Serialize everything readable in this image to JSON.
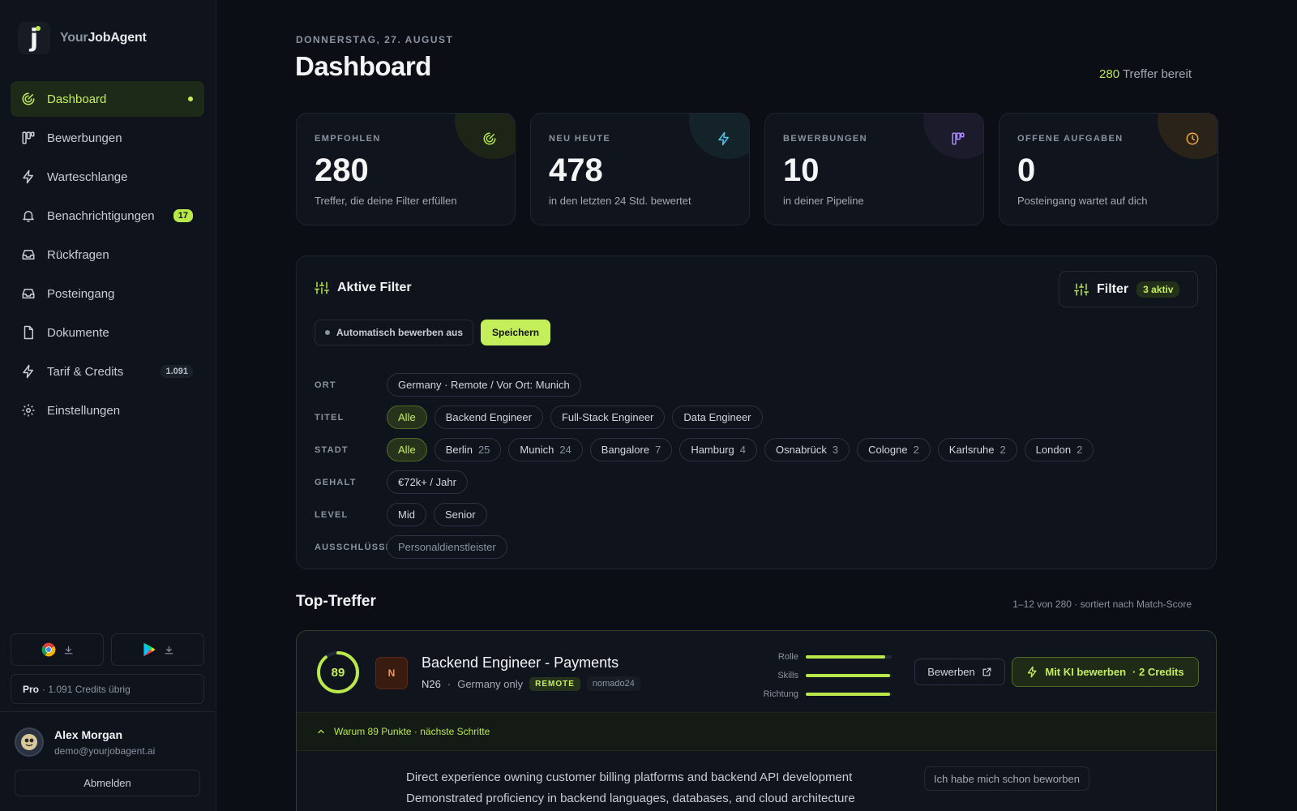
{
  "app": {
    "brand_dim": "Your",
    "brand_bold": "JobAgent"
  },
  "sidebar": {
    "items": [
      {
        "label": "Dashboard"
      },
      {
        "label": "Bewerbungen"
      },
      {
        "label": "Warteschlange"
      },
      {
        "label": "Benachrichtigungen",
        "badge": "17"
      },
      {
        "label": "Rückfragen"
      },
      {
        "label": "Posteingang"
      },
      {
        "label": "Dokumente"
      },
      {
        "label": "Tarif & Credits",
        "badge": "1.091"
      },
      {
        "label": "Einstellungen"
      }
    ],
    "plan_name": "Pro",
    "plan_text": "· 1.091 Credits übrig",
    "user_name": "Alex Morgan",
    "user_email": "demo@yourjobagent.ai",
    "logout_label": "Abmelden"
  },
  "header": {
    "date": "DONNERSTAG, 27. AUGUST",
    "title": "Dashboard",
    "ready_count": "280",
    "ready_text": "Treffer bereit"
  },
  "stats": [
    {
      "label": "EMPFOHLEN",
      "value": "280",
      "desc": "Treffer, die deine Filter erfüllen"
    },
    {
      "label": "NEU HEUTE",
      "value": "478",
      "desc": "in den letzten 24 Std. bewertet"
    },
    {
      "label": "BEWERBUNGEN",
      "value": "10",
      "desc": "in deiner Pipeline"
    },
    {
      "label": "OFFENE AUFGABEN",
      "value": "0",
      "desc": "Posteingang wartet auf dich"
    }
  ],
  "filters": {
    "title": "Aktive Filter",
    "button_label": "Filter",
    "active_count": "3 aktiv",
    "auto_label": "Automatisch bewerben aus",
    "save_label": "Speichern",
    "rows": {
      "ort": {
        "label": "ORT",
        "chips": [
          "Germany · Remote / Vor Ort: Munich"
        ]
      },
      "titel": {
        "label": "TITEL",
        "chips": [
          "Alle",
          "Backend Engineer",
          "Full-Stack Engineer",
          "Data Engineer"
        ]
      },
      "stadt": {
        "label": "STADT",
        "all": "Alle",
        "chips": [
          {
            "name": "Berlin",
            "count": "25"
          },
          {
            "name": "Munich",
            "count": "24"
          },
          {
            "name": "Bangalore",
            "count": "7"
          },
          {
            "name": "Hamburg",
            "count": "4"
          },
          {
            "name": "Osnabrück",
            "count": "3"
          },
          {
            "name": "Cologne",
            "count": "2"
          },
          {
            "name": "Karlsruhe",
            "count": "2"
          },
          {
            "name": "London",
            "count": "2"
          }
        ]
      },
      "gehalt": {
        "label": "GEHALT",
        "chips": [
          "€72k+ / Jahr"
        ]
      },
      "level": {
        "label": "LEVEL",
        "chips": [
          "Mid",
          "Senior"
        ]
      },
      "aus": {
        "label": "AUSSCHLÜSSE",
        "chips": [
          "Personaldienstleister"
        ]
      }
    }
  },
  "top": {
    "title": "Top-Treffer",
    "meta": "1–12 von 280 · sortiert nach Match-Score"
  },
  "job": {
    "score": "89",
    "score_fraction": 0.89,
    "company_initial": "N",
    "title": "Backend Engineer - Payments",
    "company": "N26",
    "separator": "·",
    "location": "Germany only",
    "remote_tag": "REMOTE",
    "source": "nomado24",
    "bars": [
      {
        "label": "Rolle",
        "value": 0.92
      },
      {
        "label": "Skills",
        "value": 0.98
      },
      {
        "label": "Richtung",
        "value": 0.98
      }
    ],
    "apply_label": "Bewerben",
    "ki_label": "Mit KI bewerben",
    "ki_credits": "· 2 Credits",
    "why_label": "Warum 89 Punkte · nächste Schritte",
    "reasons": [
      "Direct experience owning customer billing platforms and backend API development",
      "Demonstrated proficiency in backend languages, databases, and cloud architecture"
    ],
    "already_label": "Ich habe mich schon beworben"
  },
  "colors": {
    "accent": "#c4ef5b",
    "bg": "#0b0e14",
    "card": "#10141c"
  }
}
